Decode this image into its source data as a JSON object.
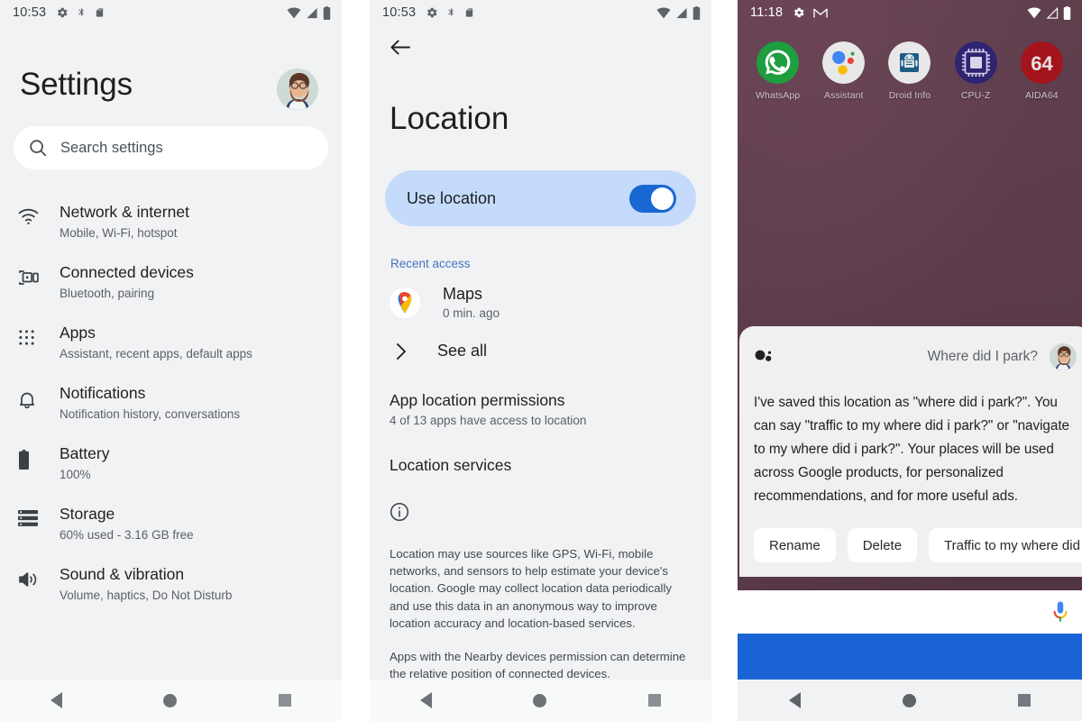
{
  "screen1": {
    "status": {
      "time": "10:53",
      "icons": [
        "gear-icon",
        "bluetooth-icon",
        "sdcard-icon"
      ],
      "right_icons": [
        "wifi-icon",
        "signal-icon",
        "battery-icon"
      ]
    },
    "title": "Settings",
    "search": {
      "placeholder": "Search settings",
      "icon": "search-icon"
    },
    "avatar_name": "user-avatar",
    "items": [
      {
        "icon": "wifi-icon",
        "title": "Network & internet",
        "subtitle": "Mobile, Wi-Fi, hotspot"
      },
      {
        "icon": "connected-devices-icon",
        "title": "Connected devices",
        "subtitle": "Bluetooth, pairing"
      },
      {
        "icon": "apps-grid-icon",
        "title": "Apps",
        "subtitle": "Assistant, recent apps, default apps"
      },
      {
        "icon": "bell-icon",
        "title": "Notifications",
        "subtitle": "Notification history, conversations"
      },
      {
        "icon": "battery-icon",
        "title": "Battery",
        "subtitle": "100%"
      },
      {
        "icon": "storage-icon",
        "title": "Storage",
        "subtitle": "60% used - 3.16 GB free"
      },
      {
        "icon": "volume-icon",
        "title": "Sound & vibration",
        "subtitle": "Volume, haptics, Do Not Disturb"
      }
    ]
  },
  "screen2": {
    "status": {
      "time": "10:53"
    },
    "back_label": "back-arrow",
    "title": "Location",
    "use_location": {
      "label": "Use location",
      "enabled": true,
      "accent": "#1967d2",
      "pill_bg": "#c5dbfb"
    },
    "recent_access_label": "Recent access",
    "recent_items": [
      {
        "icon": "google-maps-icon",
        "name": "Maps",
        "time": "0 min. ago"
      }
    ],
    "see_all_label": "See all",
    "app_permissions": {
      "title": "App location permissions",
      "subtitle": "4 of 13 apps have access to location"
    },
    "location_services_label": "Location services",
    "info": {
      "icon": "info-icon",
      "paragraph": "Location may use sources like GPS, Wi-Fi, mobile networks, and sensors to help estimate your device's location. Google may collect location data periodically and use this data in an anonymous way to improve location accuracy and location-based services.",
      "paragraph2": "Apps with the Nearby devices permission can determine the relative position of connected devices."
    }
  },
  "screen3": {
    "status": {
      "time": "11:18",
      "icons": [
        "gear-icon",
        "gmail-icon"
      ]
    },
    "dock": [
      {
        "label": "WhatsApp",
        "icon": "whatsapp-icon"
      },
      {
        "label": "Assistant",
        "icon": "google-assistant-icon"
      },
      {
        "label": "Droid Info",
        "icon": "droid-info-icon"
      },
      {
        "label": "CPU-Z",
        "icon": "cpuz-icon"
      },
      {
        "label": "AIDA64",
        "icon": "aida64-icon"
      }
    ],
    "assistant": {
      "logo": "assistant-dots-icon",
      "query": "Where did I park?",
      "avatar": "user-avatar",
      "response": "I've saved this location as \"where did i park?\". You can say \"traffic to my where did i park?\" or \"navigate to my where did i park?\". Your places will be used across Google products, for personalized recommendations, and for more useful ads.",
      "chips": [
        "Rename",
        "Delete",
        "Traffic to my where did"
      ],
      "mic_icon": "google-mic-icon",
      "accent_bar_color": "#1a63d4"
    }
  },
  "navbar": {
    "back": "back-nav-button",
    "home": "home-nav-button",
    "recents": "recents-nav-button"
  }
}
